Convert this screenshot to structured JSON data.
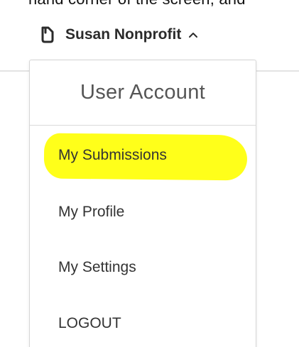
{
  "top_text": "hand corner of the screen, and",
  "account": {
    "name": "Susan Nonprofit",
    "user_icon": "user-badge-icon",
    "toggle_icon": "chevron-up-icon"
  },
  "dropdown": {
    "title": "User Account",
    "items": [
      {
        "label": "My Submissions",
        "highlighted": true
      },
      {
        "label": "My Profile"
      },
      {
        "label": "My Settings"
      },
      {
        "label": "LOGOUT"
      }
    ]
  },
  "colors": {
    "highlight": "#ffff1a",
    "text": "#333333",
    "title": "#555555",
    "border": "#d6d6d6"
  }
}
